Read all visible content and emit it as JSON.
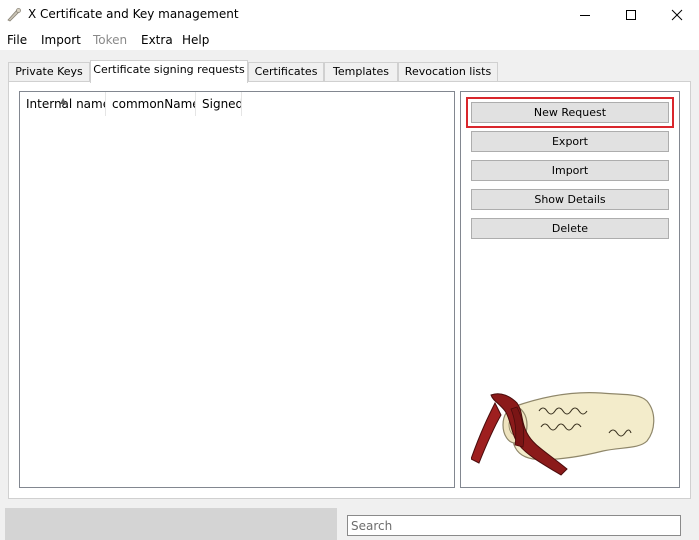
{
  "window": {
    "title": "X Certificate and Key management"
  },
  "menu": [
    {
      "label": "File",
      "enabled": true
    },
    {
      "label": "Import",
      "enabled": true
    },
    {
      "label": "Token",
      "enabled": false
    },
    {
      "label": "Extra",
      "enabled": true
    },
    {
      "label": "Help",
      "enabled": true
    }
  ],
  "tabs": [
    {
      "label": "Private Keys",
      "active": false
    },
    {
      "label": "Certificate signing requests",
      "active": true
    },
    {
      "label": "Certificates",
      "active": false
    },
    {
      "label": "Templates",
      "active": false
    },
    {
      "label": "Revocation lists",
      "active": false
    }
  ],
  "list": {
    "columns": [
      "Internal name",
      "commonName",
      "Signed"
    ],
    "rows": []
  },
  "actions": [
    {
      "label": "New Request",
      "highlighted": true
    },
    {
      "label": "Export",
      "highlighted": false
    },
    {
      "label": "Import",
      "highlighted": false
    },
    {
      "label": "Show Details",
      "highlighted": false
    },
    {
      "label": "Delete",
      "highlighted": false
    }
  ],
  "search": {
    "placeholder": "Search",
    "value": ""
  },
  "colors": {
    "highlight_border": "#d9262c",
    "ribbon": "#8b1a1a",
    "scroll_paper": "#f3eccb"
  }
}
